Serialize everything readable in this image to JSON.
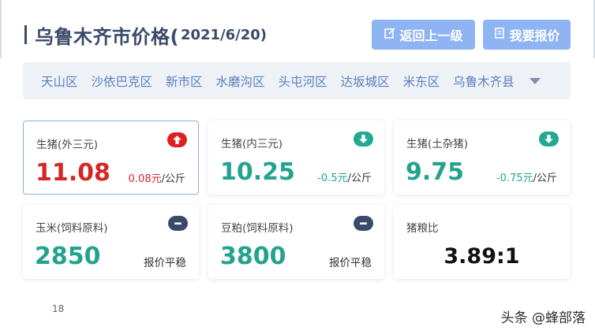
{
  "header": {
    "title": "乌鲁木齐市价格(",
    "date": " 2021/6/20)"
  },
  "buttons": {
    "back": "返回上一级",
    "report": "我要报价"
  },
  "districts": [
    "天山区",
    "沙依巴克区",
    "新市区",
    "水磨沟区",
    "头屯河区",
    "达坂城区",
    "米东区",
    "乌鲁木齐县"
  ],
  "cards": {
    "pig_outer": {
      "title": "生猪(外三元)",
      "value": "11.08",
      "change": "0.08元",
      "unit": "/公斤",
      "trend": "up"
    },
    "pig_inner": {
      "title": "生猪(内三元)",
      "value": "10.25",
      "change": "-0.5元",
      "unit": "/公斤",
      "trend": "down"
    },
    "pig_local": {
      "title": "生猪(土杂猪)",
      "value": "9.75",
      "change": "-0.75元",
      "unit": "/公斤",
      "trend": "down"
    },
    "corn": {
      "title": "玉米(饲料原料)",
      "value": "2850",
      "status": "报价平稳",
      "trend": "flat"
    },
    "soymeal": {
      "title": "豆粕(饲料原料)",
      "value": "3800",
      "status": "报价平稳",
      "trend": "flat"
    },
    "ratio": {
      "title": "猪粮比",
      "value": "3.89:1"
    }
  },
  "page_number": "18",
  "watermark": "头条 @蜂部落",
  "colors": {
    "up": "#e02020",
    "down": "#22a893",
    "flat": "#3b4a6b",
    "accent_button": "#8fb4f4",
    "title": "#3b4a6b"
  }
}
